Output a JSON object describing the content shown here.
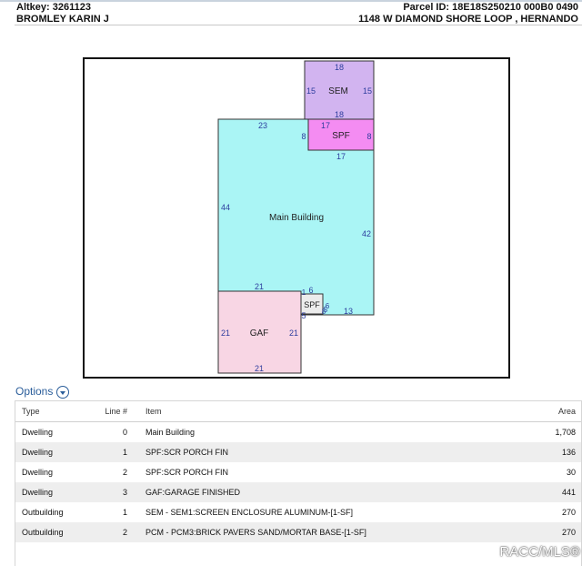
{
  "header": {
    "altkey": "Altkey: 3261123",
    "parcel": "Parcel ID: 18E18S250210 000B0 0490",
    "owner": "BROMLEY KARIN J",
    "address": "1148 W DIAMOND SHORE LOOP , HERNANDO"
  },
  "sketch": {
    "areas": {
      "sem": "SEM",
      "spf1": "SPF",
      "main": "Main Building",
      "spf2": "SPF",
      "gaf": "GAF"
    },
    "dims": {
      "sem_top": "18",
      "sem_left": "15",
      "sem_right": "15",
      "sem_bottom": "18",
      "spf1_top": "17",
      "spf1_left": "8",
      "spf1_right": "8",
      "spf1_bottom": "17",
      "main_top": "23",
      "main_left": "44",
      "main_right": "42",
      "main_bottom": "13",
      "gaf_top": "21",
      "gaf_left": "21",
      "gaf_right": "21",
      "gaf_bottom": "21",
      "spf2_a": "1",
      "spf2_b": "6",
      "spf2_c": "5",
      "spf2_d": "6",
      "spf2_e": "5",
      "spf2_f": "8"
    },
    "colors": {
      "sem": "#d2b4f0",
      "spf1": "#f48cf2",
      "main": "#aaf5f5",
      "gaf": "#f8d6e4",
      "spf2": "#ececec"
    }
  },
  "options": {
    "label": "Options",
    "icon": "chevron-down-circle-icon"
  },
  "table": {
    "headers": {
      "type": "Type",
      "line": "Line #",
      "item": "Item",
      "area": "Area"
    },
    "rows": [
      {
        "type": "Dwelling",
        "line": "0",
        "item": "Main Building",
        "area": "1,708"
      },
      {
        "type": "Dwelling",
        "line": "1",
        "item": "SPF:SCR PORCH FIN",
        "area": "136"
      },
      {
        "type": "Dwelling",
        "line": "2",
        "item": "SPF:SCR PORCH FIN",
        "area": "30"
      },
      {
        "type": "Dwelling",
        "line": "3",
        "item": "GAF:GARAGE FINISHED",
        "area": "441"
      },
      {
        "type": "Outbuilding",
        "line": "1",
        "item": "SEM - SEM1:SCREEN ENCLOSURE ALUMINUM-[1-SF]",
        "area": "270"
      },
      {
        "type": "Outbuilding",
        "line": "2",
        "item": "PCM - PCM3:BRICK PAVERS SAND/MORTAR BASE-[1-SF]",
        "area": "270"
      }
    ]
  },
  "watermark": "RACC/MLS®"
}
